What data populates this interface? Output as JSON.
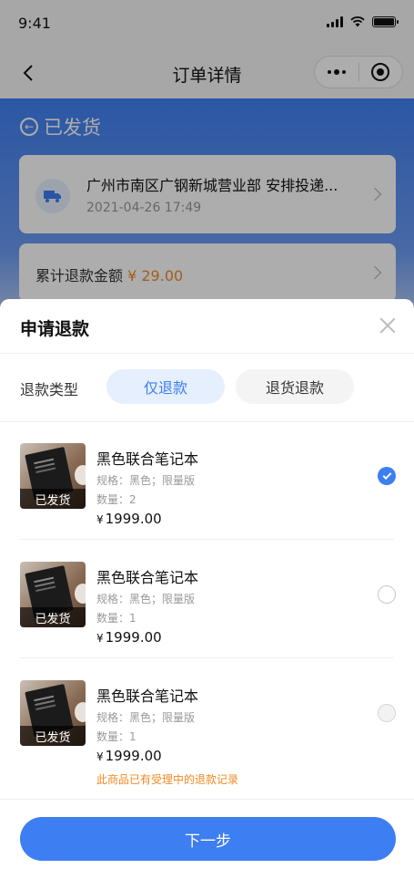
{
  "status_bar": {
    "time": "9:41"
  },
  "nav": {
    "title": "订单详情"
  },
  "order": {
    "status": "已发货",
    "logistics_text": "广州市南区广钢新城营业部 安排投递...",
    "logistics_time": "2021-04-26 17:49",
    "refund_total_label": "累计退款金额",
    "refund_total_amount": "¥ 29.00"
  },
  "sheet": {
    "title": "申请退款",
    "type_label": "退款类型",
    "types": [
      "仅退款",
      "退货退款"
    ],
    "selected_type": "仅退款",
    "items": [
      {
        "tag": "已发货",
        "name": "黑色联合笔记本",
        "spec": "规格：黑色；限量版",
        "qty": "数量：2",
        "currency": "¥",
        "price": "1999.00",
        "selected": true,
        "note": ""
      },
      {
        "tag": "已发货",
        "name": "黑色联合笔记本",
        "spec": "规格：黑色；限量版",
        "qty": "数量：1",
        "currency": "¥",
        "price": "1999.00",
        "selected": false,
        "note": ""
      },
      {
        "tag": "已发货",
        "name": "黑色联合笔记本",
        "spec": "规格：黑色；限量版",
        "qty": "数量：1",
        "currency": "¥",
        "price": "1999.00",
        "selected": false,
        "disabled": true,
        "note": "此商品已有受理中的退款记录"
      }
    ],
    "next_button": "下一步"
  },
  "colors": {
    "accent": "#3d7ef2",
    "price_orange": "#f08a24"
  }
}
